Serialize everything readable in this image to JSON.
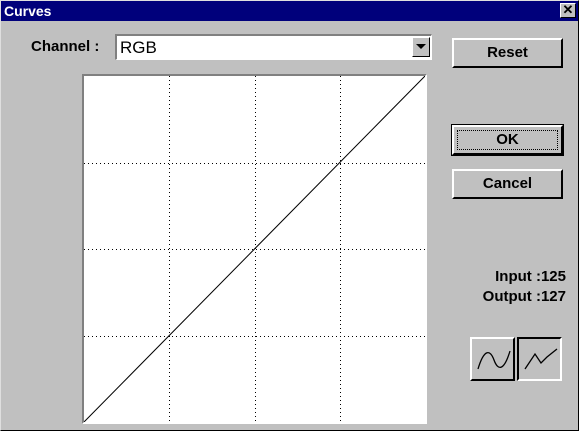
{
  "window": {
    "title": "Curves",
    "close_glyph": "✕"
  },
  "channel": {
    "label": "Channel :",
    "selected": "RGB"
  },
  "buttons": {
    "reset": "Reset",
    "ok": "OK",
    "cancel": "Cancel"
  },
  "readout": {
    "input_label": "Input :",
    "input_value": "125",
    "output_label": "Output :",
    "output_value": "127"
  },
  "curve_tools": [
    {
      "icon": "smooth-curve-icon",
      "pressed": false
    },
    {
      "icon": "polyline-curve-icon",
      "pressed": true
    }
  ],
  "curve": {
    "grid_divisions": 4,
    "points": [
      [
        0,
        0
      ],
      [
        255,
        255
      ]
    ],
    "line_color": "#000000"
  }
}
